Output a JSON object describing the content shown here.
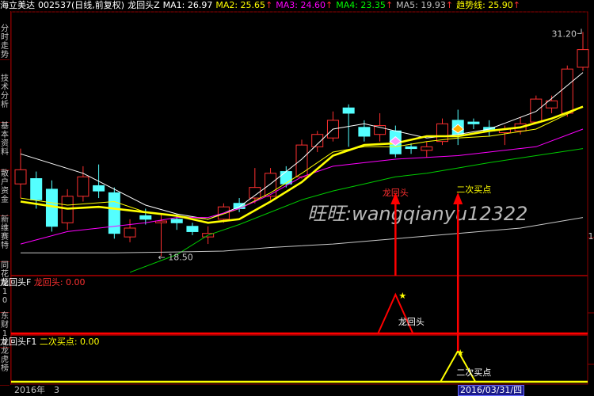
{
  "titlebar": {
    "stock": "海立美达",
    "code_period": "002537(日线,前复权)",
    "indicator": "龙回头Z",
    "ma1": "MA1: 26.97",
    "ma2": "MA2: 25.65",
    "ma3": "MA3: 24.60",
    "ma4": "MA4: 23.35",
    "ma5": "MA5: 19.93",
    "trend": "趋势线: 25.90",
    "arrow": "↑",
    "colors": {
      "ma1": "#ffffff",
      "ma2": "#ffff00",
      "ma3": "#ff00ff",
      "ma4": "#00ff00",
      "ma5": "#c0c0c0",
      "trend": "#ffff00",
      "arrow": "#ff3030"
    }
  },
  "sidebar": {
    "tabs": [
      "分时走势",
      "技术分析",
      "基本资料",
      "散户资金",
      "新维赛特",
      "同花顺10",
      "东财10",
      "龙虎榜"
    ]
  },
  "price_panel": {
    "high_label": "31.20",
    "low_label": "← 18.50",
    "right_label": "1",
    "watermark": "旺旺:wangqianyu12322",
    "annotations": {
      "pattern": "龙回头",
      "buy": "二次买点"
    }
  },
  "indicator1": {
    "name": "龙回头F",
    "value_label": "龙回头: 0.00",
    "peak_label": "龙回头"
  },
  "indicator2": {
    "name": "龙回头F1",
    "value_label": "二次买点: 0.00",
    "peak_label": "二次买点"
  },
  "bottombar": {
    "year": "2016年",
    "page": "3",
    "date": "2016/03/31/四"
  },
  "chart_data": {
    "type": "candlestick",
    "y_range": [
      17.5,
      32.2
    ],
    "high": 31.2,
    "low": 18.5,
    "candles": [
      {
        "o": 22.6,
        "c": 23.4,
        "h": 24.6,
        "l": 21.8
      },
      {
        "o": 22.9,
        "c": 21.7,
        "h": 23.3,
        "l": 21.2
      },
      {
        "o": 22.3,
        "c": 20.2,
        "h": 22.8,
        "l": 19.9
      },
      {
        "o": 20.4,
        "c": 21.9,
        "h": 22.3,
        "l": 20.0
      },
      {
        "o": 21.9,
        "c": 23.0,
        "h": 23.6,
        "l": 21.6
      },
      {
        "o": 22.5,
        "c": 22.2,
        "h": 23.7,
        "l": 21.8
      },
      {
        "o": 22.1,
        "c": 19.8,
        "h": 22.4,
        "l": 19.5
      },
      {
        "o": 19.6,
        "c": 20.1,
        "h": 20.6,
        "l": 19.3
      },
      {
        "o": 20.8,
        "c": 20.6,
        "h": 21.2,
        "l": 20.3
      },
      {
        "o": 20.4,
        "c": 20.5,
        "h": 20.9,
        "l": 18.5
      },
      {
        "o": 20.6,
        "c": 20.4,
        "h": 20.9,
        "l": 20.0
      },
      {
        "o": 20.2,
        "c": 19.9,
        "h": 20.4,
        "l": 19.7
      },
      {
        "o": 19.6,
        "c": 19.8,
        "h": 20.2,
        "l": 19.2
      },
      {
        "o": 20.6,
        "c": 21.3,
        "h": 21.5,
        "l": 20.4
      },
      {
        "o": 21.5,
        "c": 21.2,
        "h": 21.8,
        "l": 21.0
      },
      {
        "o": 21.8,
        "c": 22.4,
        "h": 23.5,
        "l": 21.5
      },
      {
        "o": 21.9,
        "c": 23.2,
        "h": 23.5,
        "l": 21.7
      },
      {
        "o": 23.3,
        "c": 22.6,
        "h": 23.6,
        "l": 22.4
      },
      {
        "o": 23.0,
        "c": 24.8,
        "h": 25.1,
        "l": 22.9
      },
      {
        "o": 24.7,
        "c": 25.4,
        "h": 25.6,
        "l": 24.4
      },
      {
        "o": 25.2,
        "c": 26.2,
        "h": 26.7,
        "l": 25.0
      },
      {
        "o": 26.9,
        "c": 26.6,
        "h": 27.1,
        "l": 24.7
      },
      {
        "o": 25.8,
        "c": 25.3,
        "h": 26.2,
        "l": 25.0
      },
      {
        "o": 25.4,
        "c": 25.9,
        "h": 26.6,
        "l": 25.0
      },
      {
        "o": 25.6,
        "c": 24.3,
        "h": 25.9,
        "l": 24.1
      },
      {
        "o": 24.7,
        "c": 24.6,
        "h": 24.9,
        "l": 24.3
      },
      {
        "o": 24.5,
        "c": 24.7,
        "h": 25.0,
        "l": 24.1
      },
      {
        "o": 25.0,
        "c": 26.0,
        "h": 26.3,
        "l": 24.8
      },
      {
        "o": 26.2,
        "c": 25.4,
        "h": 26.8,
        "l": 24.8
      },
      {
        "o": 26.1,
        "c": 26.0,
        "h": 26.3,
        "l": 25.7
      },
      {
        "o": 25.8,
        "c": 25.6,
        "h": 26.2,
        "l": 25.3
      },
      {
        "o": 25.5,
        "c": 25.7,
        "h": 25.9,
        "l": 24.8
      },
      {
        "o": 25.6,
        "c": 26.0,
        "h": 26.4,
        "l": 25.4
      },
      {
        "o": 26.1,
        "c": 27.4,
        "h": 27.6,
        "l": 26.0
      },
      {
        "o": 26.9,
        "c": 27.3,
        "h": 27.6,
        "l": 26.6
      },
      {
        "o": 26.6,
        "c": 29.1,
        "h": 29.3,
        "l": 26.4
      },
      {
        "o": 29.2,
        "c": 30.2,
        "h": 31.2,
        "l": 29.0
      }
    ],
    "ma_series": [
      {
        "name": "MA1",
        "color": "#ffffff",
        "values": [
          [
            0,
            24.3
          ],
          [
            4,
            23.2
          ],
          [
            8,
            21.4
          ],
          [
            10,
            20.9
          ],
          [
            12,
            20.6
          ],
          [
            14,
            21.3
          ],
          [
            16,
            22.6
          ],
          [
            18,
            24.0
          ],
          [
            20,
            25.7
          ],
          [
            22,
            26.0
          ],
          [
            24,
            25.6
          ],
          [
            26,
            25.2
          ],
          [
            28,
            25.4
          ],
          [
            30,
            25.7
          ],
          [
            33,
            26.7
          ],
          [
            36,
            28.9
          ]
        ]
      },
      {
        "name": "MA2",
        "color": "#ffff00",
        "values": [
          [
            0,
            21.8
          ],
          [
            3,
            21.4
          ],
          [
            6,
            21.6
          ],
          [
            8,
            21.0
          ],
          [
            10,
            20.8
          ],
          [
            12,
            20.6
          ],
          [
            14,
            21.2
          ],
          [
            16,
            22.1
          ],
          [
            18,
            23.2
          ],
          [
            20,
            24.4
          ],
          [
            22,
            24.7
          ],
          [
            24,
            24.7
          ],
          [
            26,
            25.0
          ],
          [
            28,
            25.2
          ],
          [
            30,
            25.3
          ],
          [
            33,
            25.7
          ],
          [
            36,
            26.97
          ]
        ]
      },
      {
        "name": "MA3",
        "color": "#ff00ff",
        "values": [
          [
            0,
            19.2
          ],
          [
            3,
            19.9
          ],
          [
            6,
            20.2
          ],
          [
            8,
            20.4
          ],
          [
            10,
            20.7
          ],
          [
            12,
            20.7
          ],
          [
            14,
            21.2
          ],
          [
            16,
            22.0
          ],
          [
            18,
            23.0
          ],
          [
            20,
            23.6
          ],
          [
            22,
            23.8
          ],
          [
            24,
            24.0
          ],
          [
            26,
            24.1
          ],
          [
            28,
            24.2
          ],
          [
            30,
            24.4
          ],
          [
            33,
            24.7
          ],
          [
            36,
            25.7
          ]
        ]
      },
      {
        "name": "MA4",
        "color": "#00cc00",
        "values": [
          [
            7,
            17.6
          ],
          [
            10,
            18.6
          ],
          [
            12,
            19.7
          ],
          [
            14,
            20.3
          ],
          [
            16,
            21.0
          ],
          [
            18,
            21.7
          ],
          [
            20,
            22.2
          ],
          [
            22,
            22.6
          ],
          [
            24,
            23.0
          ],
          [
            26,
            23.2
          ],
          [
            28,
            23.5
          ],
          [
            30,
            23.8
          ],
          [
            33,
            24.2
          ],
          [
            36,
            24.6
          ]
        ]
      },
      {
        "name": "MA5",
        "color": "#c8c8c8",
        "values": [
          [
            0,
            18.7
          ],
          [
            6,
            18.7
          ],
          [
            10,
            18.75
          ],
          [
            13,
            18.8
          ],
          [
            16,
            19.0
          ],
          [
            20,
            19.2
          ],
          [
            24,
            19.5
          ],
          [
            28,
            19.8
          ],
          [
            32,
            20.1
          ],
          [
            36,
            20.7
          ]
        ]
      },
      {
        "name": "趋势线",
        "color": "#ffff00",
        "values": [
          [
            0,
            21.6
          ],
          [
            3,
            21.2
          ],
          [
            5,
            21.3
          ],
          [
            7,
            21.1
          ],
          [
            10,
            20.8
          ],
          [
            12,
            20.4
          ],
          [
            14,
            20.6
          ],
          [
            16,
            21.6
          ],
          [
            18,
            22.7
          ],
          [
            20,
            24.2
          ],
          [
            22,
            24.8
          ],
          [
            24,
            24.9
          ],
          [
            26,
            25.3
          ],
          [
            28,
            25.3
          ],
          [
            30,
            25.6
          ],
          [
            32,
            25.8
          ],
          [
            34,
            26.3
          ],
          [
            36,
            26.97
          ]
        ]
      }
    ],
    "signals": [
      {
        "index": 24,
        "label": "龙回头",
        "type": "pattern"
      },
      {
        "index": 28,
        "label": "二次买点",
        "type": "buy"
      }
    ]
  }
}
